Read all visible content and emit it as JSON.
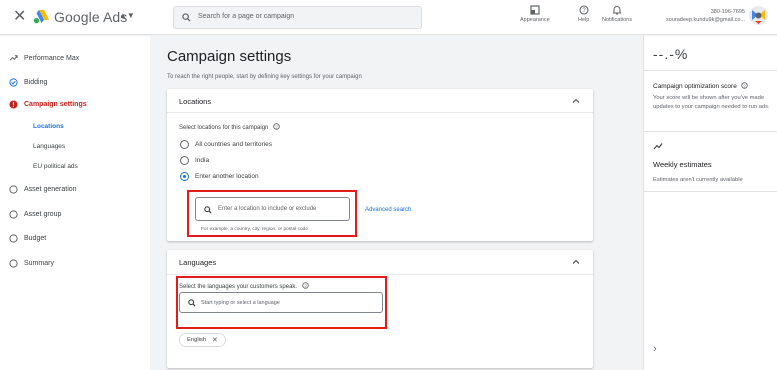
{
  "topbar": {
    "close_icon": "close-icon",
    "brand": "Google Ads",
    "search_placeholder": "Search for a page or campaign",
    "tools": [
      {
        "label": "Appearance",
        "icon": "appearance-icon"
      },
      {
        "label": "Help",
        "icon": "help-icon"
      },
      {
        "label": "Notifications",
        "icon": "bell-icon"
      }
    ],
    "account_id": "380-196-7695",
    "account_email": "souradeep.kundu9k@gmail.co..."
  },
  "sidebar": {
    "items": [
      {
        "label": "Performance Max",
        "icon": "performance-max-icon"
      },
      {
        "label": "Bidding",
        "icon": "check-circle-icon"
      },
      {
        "label": "Campaign settings",
        "icon": "error-icon"
      },
      {
        "label": "Asset generation",
        "icon": "radio-empty-icon"
      },
      {
        "label": "Asset group",
        "icon": "radio-empty-icon"
      },
      {
        "label": "Budget",
        "icon": "radio-empty-icon"
      },
      {
        "label": "Summary",
        "icon": "radio-empty-icon"
      }
    ],
    "sub_items": [
      "Locations",
      "Languages",
      "EU political ads"
    ]
  },
  "main": {
    "title": "Campaign settings",
    "subtitle": "To reach the right people, start by defining key settings for your campaign",
    "locations": {
      "title": "Locations",
      "prompt": "Select locations for this campaign",
      "options": [
        "All countries and territories",
        "India",
        "Enter another location"
      ],
      "selected_index": 2,
      "input_placeholder": "Enter a location to include or exclude",
      "helper": "For example, a country, city, region, or postal code",
      "advanced_link": "Advanced search"
    },
    "languages": {
      "title": "Languages",
      "prompt": "Select the languages your customers speak.",
      "input_placeholder": "Start typing or select a language",
      "chip": "English"
    }
  },
  "right_panel": {
    "score": "--.-%",
    "score_title": "Campaign optimization score",
    "score_text": "Your score will be shown after you've made updates to your campaign needed to run ads.",
    "weekly_title": "Weekly estimates",
    "weekly_text": "Estimates aren't currently available"
  },
  "colors": {
    "accent": "#1a73e8",
    "error": "#c5221f",
    "highlight": "#e21b1b"
  }
}
